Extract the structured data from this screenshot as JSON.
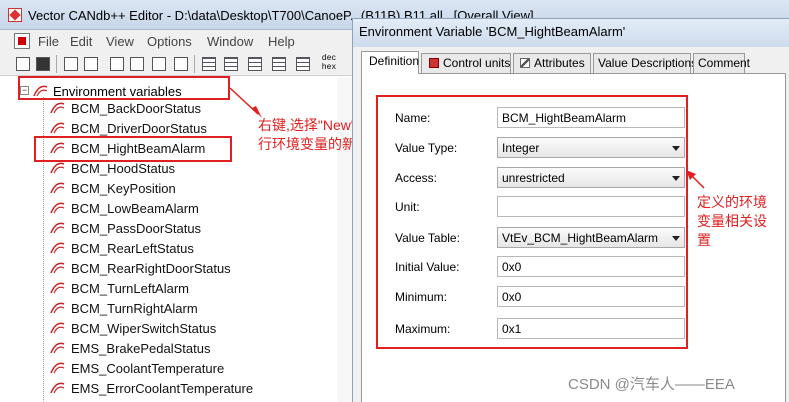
{
  "window": {
    "title": "Vector CANdb++ Editor - D:\\data\\Desktop\\T700\\CanoeP...(B11B) B11 all...[Overall View]",
    "colors": {
      "annotation": "#e02020",
      "titlebar": "#c7d6ea"
    }
  },
  "menu": {
    "items": [
      {
        "label": "File"
      },
      {
        "label": "Edit"
      },
      {
        "label": "View"
      },
      {
        "label": "Options"
      },
      {
        "label": "Window"
      },
      {
        "label": "Help"
      }
    ]
  },
  "toolbar": {
    "buttons": [
      {
        "icon": "new-icon"
      },
      {
        "icon": "save-icon"
      },
      {
        "icon": "copy-icon"
      },
      {
        "icon": "paste-icon"
      },
      {
        "icon": "properties-icon"
      },
      {
        "icon": "tools-icon"
      },
      {
        "icon": "table-view-icon"
      },
      {
        "icon": "list-view-icon"
      },
      {
        "icon": "grid-view-icon"
      },
      {
        "icon": "detail-view-icon"
      },
      {
        "icon": "matrix-view-icon"
      }
    ],
    "dec_hex": "dec\nhex"
  },
  "tree": {
    "root": {
      "label": "Environment variables",
      "expander": "−"
    },
    "items": [
      "BCM_BackDoorStatus",
      "BCM_DriverDoorStatus",
      "BCM_HightBeamAlarm",
      "BCM_HoodStatus",
      "BCM_KeyPosition",
      "BCM_LowBeamAlarm",
      "BCM_PassDoorStatus",
      "BCM_RearLeftStatus",
      "BCM_RearRightDoorStatus",
      "BCM_TurnLeftAlarm",
      "BCM_TurnRightAlarm",
      "BCM_WiperSwitchStatus",
      "EMS_BrakePedalStatus",
      "EMS_CoolantTemperature",
      "EMS_ErrorCoolantTemperature"
    ],
    "selected_index": 2
  },
  "annotations": {
    "left_text": [
      "右键,选择\"New\"进",
      "行环境变量的新建"
    ],
    "right_text": [
      "定义的环境",
      "变量相关设",
      "置"
    ]
  },
  "dialog": {
    "title": "Environment Variable 'BCM_HightBeamAlarm'",
    "tabs": [
      {
        "label": "Definition",
        "active": true,
        "icon": ""
      },
      {
        "label": "Control units",
        "active": false,
        "icon": "control-units-icon"
      },
      {
        "label": "Attributes",
        "active": false,
        "icon": "attributes-icon"
      },
      {
        "label": "Value Descriptions",
        "active": false,
        "icon": ""
      },
      {
        "label": "Comment",
        "active": false,
        "icon": ""
      }
    ],
    "fields": [
      {
        "label": "Name:",
        "kind": "text",
        "value": "BCM_HightBeamAlarm"
      },
      {
        "label": "Value Type:",
        "kind": "select",
        "value": "Integer"
      },
      {
        "label": "Access:",
        "kind": "select",
        "value": "unrestricted"
      },
      {
        "label": "Unit:",
        "kind": "text",
        "value": ""
      },
      {
        "label": "Value Table:",
        "kind": "select",
        "value": "VtEv_BCM_HightBeamAlarm"
      },
      {
        "label": "Initial Value:",
        "kind": "text",
        "value": "0x0"
      },
      {
        "label": "Minimum:",
        "kind": "text",
        "value": "0x0"
      },
      {
        "label": "Maximum:",
        "kind": "text",
        "value": "0x1"
      }
    ]
  },
  "watermark": "CSDN @汽车人——EEA"
}
